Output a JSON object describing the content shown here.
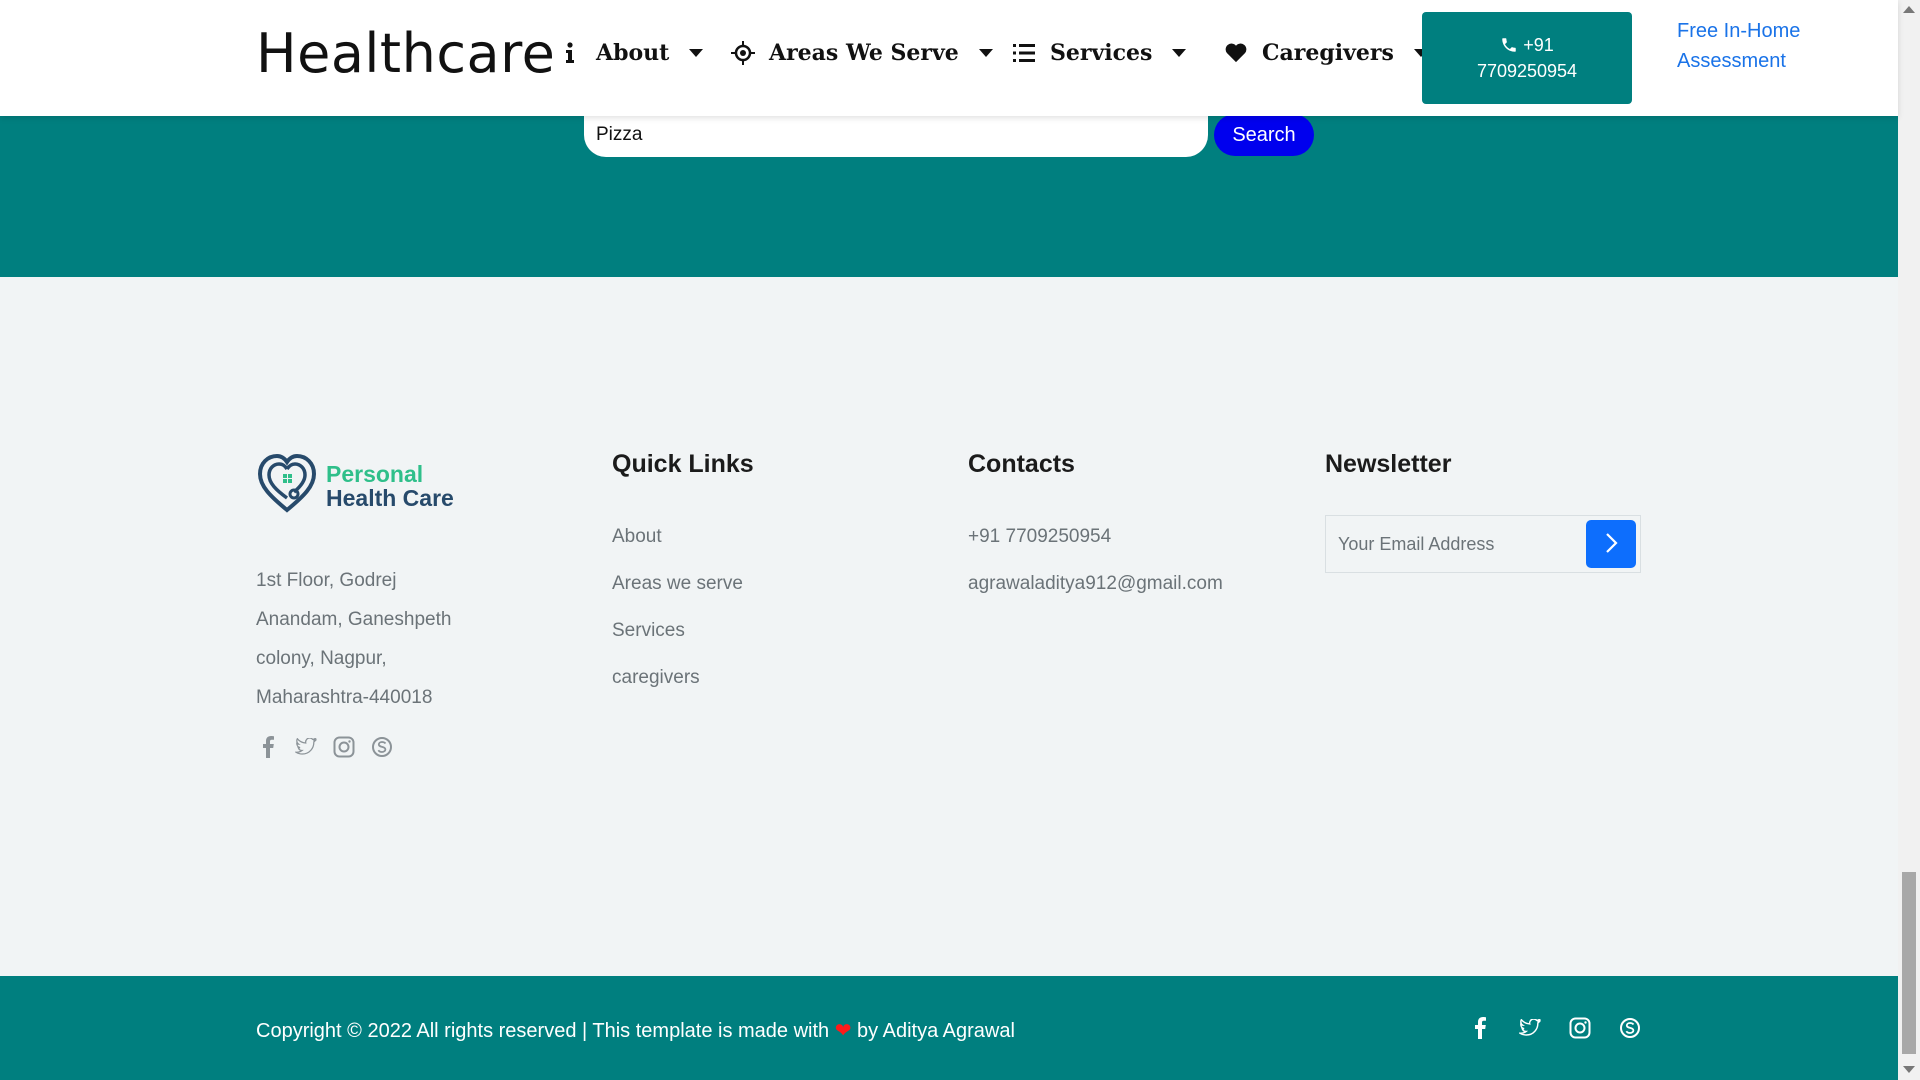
{
  "navbar": {
    "brand": "Healthcare",
    "items": [
      {
        "label": "About",
        "icon": "info-icon"
      },
      {
        "label": "Areas We Serve",
        "icon": "crosshair-icon"
      },
      {
        "label": "Services",
        "icon": "list-icon"
      },
      {
        "label": "Caregivers",
        "icon": "heart-icon"
      }
    ],
    "phone_line1": "+91",
    "phone_line2": "7709250954",
    "assessment": "Free In-Home Assessment"
  },
  "search": {
    "value": "Pizza",
    "button": "Search"
  },
  "footer": {
    "logo_line1": "Personal",
    "logo_line2": "Health Care",
    "address": "1st Floor, Godrej Anandam, Ganeshpeth colony, Nagpur, Maharashtra-440018",
    "quick_links_title": "Quick Links",
    "quick_links": [
      "About",
      "Areas we serve",
      "Services",
      "caregivers"
    ],
    "contacts_title": "Contacts",
    "phone": "+91 7709250954",
    "email": "agrawaladitya912@gmail.com",
    "newsletter_title": "Newsletter",
    "newsletter_placeholder": "Your Email Address"
  },
  "bottom": {
    "copyright_pre": "Copyright © 2022 All rights reserved | This template is made with",
    "copyright_post": "by Aditya Agrawal",
    "socials": [
      "facebook-icon",
      "twitter-icon",
      "instagram-icon",
      "skype-icon"
    ]
  },
  "colors": {
    "teal": "#007f7f",
    "search_button": "#0000ee",
    "newsletter_button": "#0d6efd",
    "link_blue": "#1a73e8"
  }
}
